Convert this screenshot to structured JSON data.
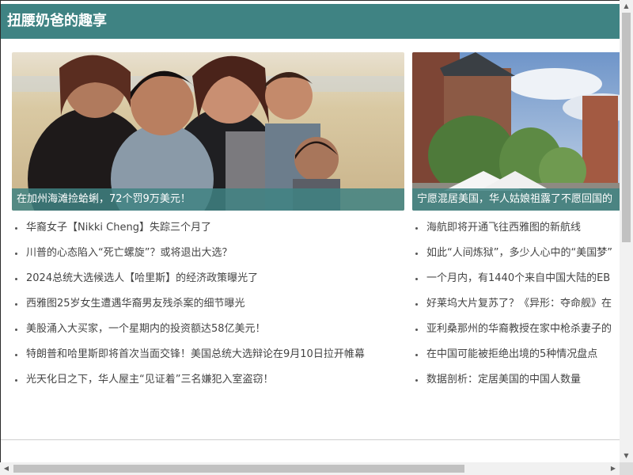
{
  "header": {
    "title": "扭腰奶爸的趣享"
  },
  "cards": [
    {
      "caption": "在加州海滩捡蛤蜊，72个罚9万美元！",
      "image": "family-beach-photo"
    },
    {
      "caption": "宁愿混居美国，华人姑娘祖露了不愿回国的",
      "image": "town-street-photo"
    }
  ],
  "list_left": [
    "华裔女子【Nikki Cheng】失踪三个月了",
    "川普的心态陷入“死亡螺旋”？或将退出大选？",
    "2024总统大选候选人【哈里斯】的经济政策曝光了",
    "西雅图25岁女生遭遇华裔男友残杀案的细节曝光",
    "美股涌入大买家，一个星期内的投资额达58亿美元！",
    "特朗普和哈里斯即将首次当面交锋！美国总统大选辩论在9月10日拉开帷幕",
    "光天化日之下，华人屋主“见证着”三名嫌犯入室盗窃！"
  ],
  "list_right": [
    "海航即将开通飞往西雅图的新航线",
    "如此“人间炼狱”，多少人心中的“美国梦”",
    "一个月内，有1440个来自中国大陆的EB",
    "好莱坞大片复苏了？《异形：夺命舰》在",
    "亚利桑那州的华裔教授在家中枪杀妻子的",
    "在中国可能被拒绝出境的5种情况盘点",
    "数据剖析：定居美国的中国人数量"
  ],
  "scrollbar": {
    "up_arrow": "▲",
    "down_arrow": "▼",
    "left_arrow": "◀",
    "right_arrow": "▶"
  },
  "colors": {
    "accent": "#3f8383"
  }
}
